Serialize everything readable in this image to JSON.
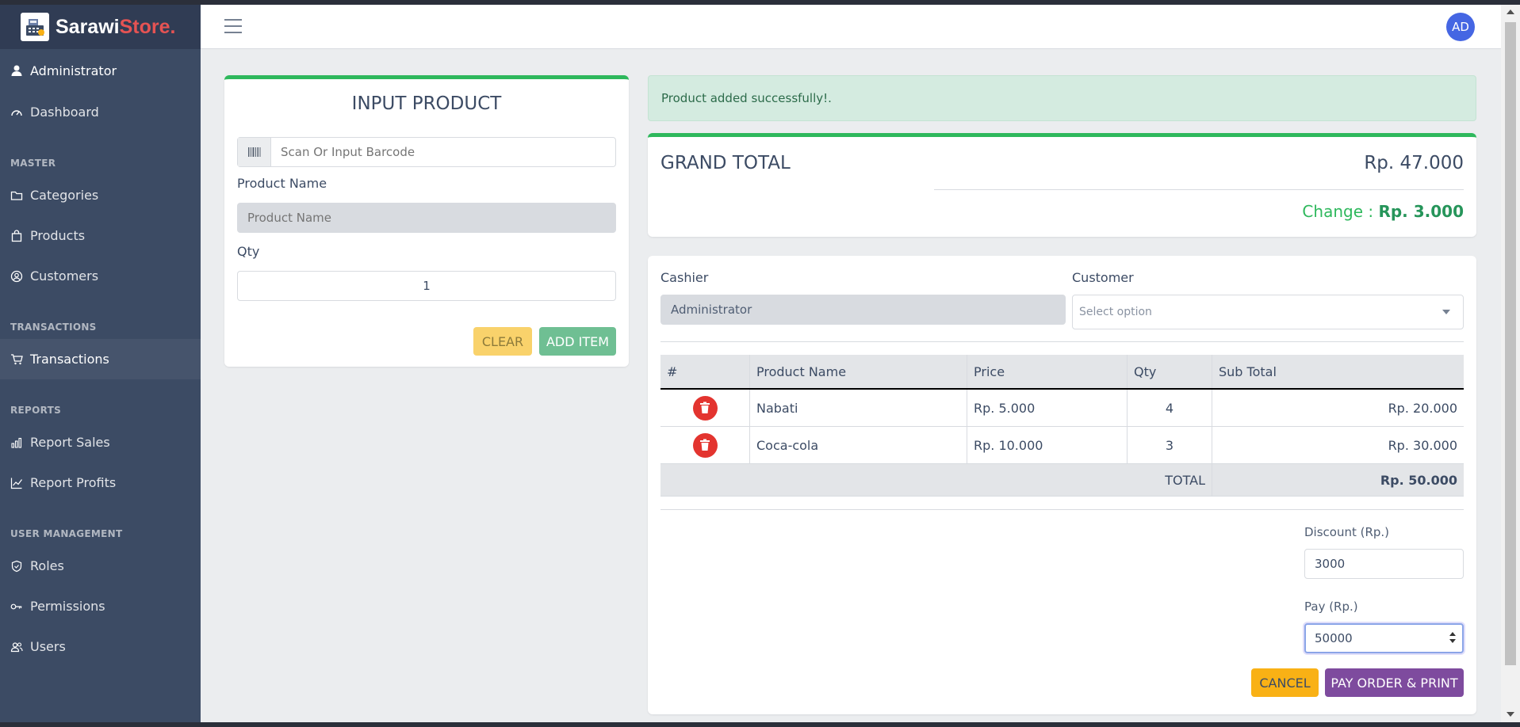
{
  "brand": {
    "name_part1": "Sarawi",
    "name_part2": "Store."
  },
  "sidebar": {
    "user": "Administrator",
    "dashboard": "Dashboard",
    "master_title": "MASTER",
    "categories": "Categories",
    "products": "Products",
    "customers": "Customers",
    "transactions_title": "TRANSACTIONS",
    "transactions": "Transactions",
    "reports_title": "REPORTS",
    "report_sales": "Report Sales",
    "report_profits": "Report Profits",
    "user_management_title": "USER MANAGEMENT",
    "roles": "Roles",
    "permissions": "Permissions",
    "users": "Users"
  },
  "header": {
    "avatar_initials": "AD"
  },
  "input_product": {
    "title": "INPUT PRODUCT",
    "barcode_placeholder": "Scan Or Input Barcode",
    "product_name_label": "Product Name",
    "product_name_placeholder": "Product Name",
    "qty_label": "Qty",
    "qty_value": "1",
    "clear_label": "CLEAR",
    "add_item_label": "ADD ITEM"
  },
  "alert": {
    "message": "Product added successfully!."
  },
  "grand_total": {
    "label": "GRAND TOTAL",
    "value": "Rp. 47.000",
    "change_label": "Change :",
    "change_value": "Rp. 3.000"
  },
  "order": {
    "cashier_label": "Cashier",
    "cashier_value": "Administrator",
    "customer_label": "Customer",
    "customer_placeholder": "Select option",
    "table": {
      "headers": [
        "#",
        "Product Name",
        "Price",
        "Qty",
        "Sub Total"
      ],
      "rows": [
        {
          "product": "Nabati",
          "price": "Rp. 5.000",
          "qty": "4",
          "subtotal": "Rp. 20.000"
        },
        {
          "product": "Coca-cola",
          "price": "Rp. 10.000",
          "qty": "3",
          "subtotal": "Rp. 30.000"
        }
      ],
      "total_label": "TOTAL",
      "total_value": "Rp. 50.000"
    },
    "discount_label": "Discount (Rp.)",
    "discount_value": "3000",
    "pay_label": "Pay (Rp.)",
    "pay_value": "50000",
    "cancel_label": "CANCEL",
    "pay_button_label": "PAY ORDER & PRINT"
  },
  "colors": {
    "sidebar_bg": "#3c4b64",
    "brand_accent": "#e55353",
    "success": "#2eb85c",
    "warning": "#f9b115",
    "danger": "#e3342f",
    "purple": "#7e4b9e",
    "avatar_bg": "#4566e3"
  },
  "icons": {
    "brand": "cash-register-icon",
    "user": "user-icon",
    "dashboard": "speedometer-icon",
    "categories": "folder-icon",
    "products": "bag-icon",
    "customers": "user-circle-icon",
    "transactions": "cart-icon",
    "report_sales": "bar-chart-icon",
    "report_profits": "line-chart-icon",
    "roles": "shield-icon",
    "permissions": "key-icon",
    "users": "users-icon",
    "barcode": "barcode-icon",
    "delete": "trash-icon",
    "menu": "hamburger-icon"
  }
}
